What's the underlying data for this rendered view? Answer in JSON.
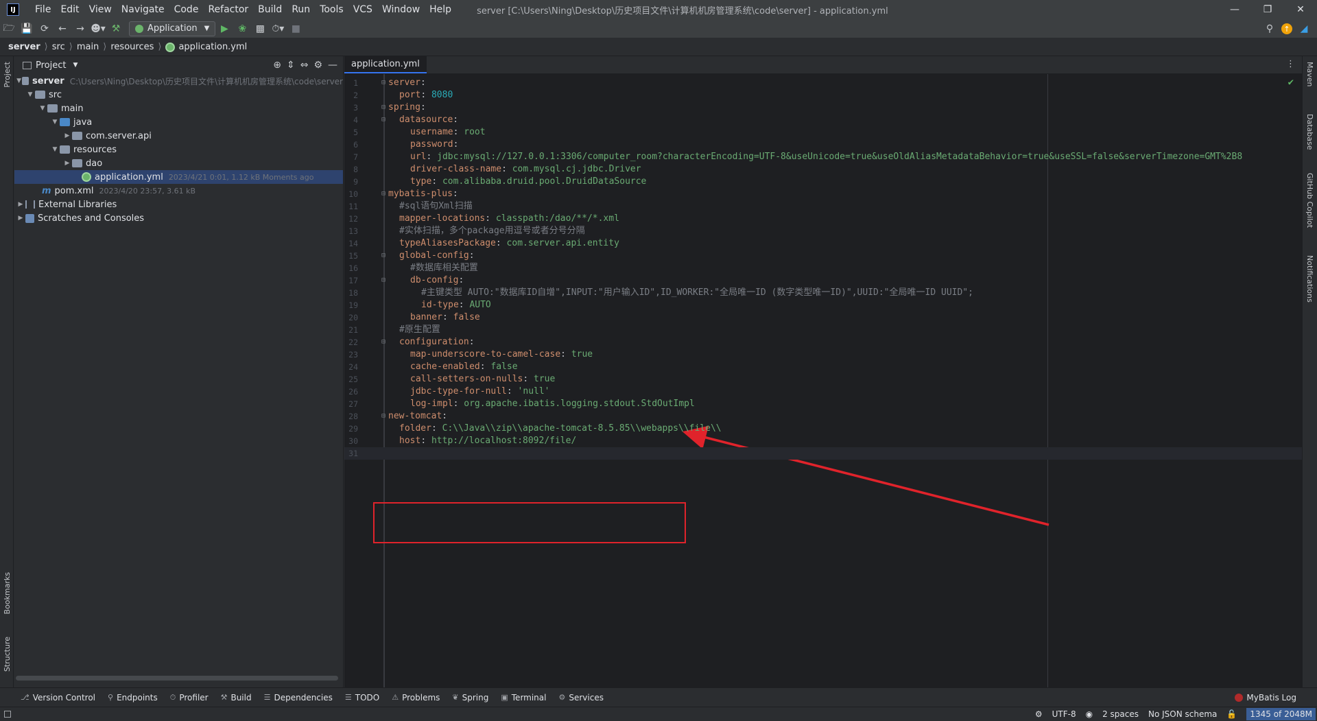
{
  "window": {
    "title": "server [C:\\Users\\Ning\\Desktop\\历史项目文件\\计算机机房管理系统\\code\\server] - application.yml",
    "menu": [
      "File",
      "Edit",
      "View",
      "Navigate",
      "Code",
      "Refactor",
      "Build",
      "Run",
      "Tools",
      "VCS",
      "Window",
      "Help"
    ]
  },
  "toolbar": {
    "run_config": "Application"
  },
  "breadcrumb": [
    "server",
    "src",
    "main",
    "resources",
    "application.yml"
  ],
  "left_stripe": {
    "project": "Project",
    "bookmarks": "Bookmarks",
    "structure": "Structure"
  },
  "project_panel": {
    "title": "Project",
    "tree": {
      "root": {
        "name": "server",
        "path": "C:\\Users\\Ning\\Desktop\\历史项目文件\\计算机机房管理系统\\code\\server"
      },
      "src": "src",
      "main": "main",
      "java": "java",
      "pkg": "com.server.api",
      "resources": "resources",
      "dao": "dao",
      "app_yml": {
        "name": "application.yml",
        "meta": "2023/4/21 0:01, 1.12 kB Moments ago"
      },
      "pom": {
        "name": "pom.xml",
        "meta": "2023/4/20 23:57, 3.61 kB"
      },
      "ext_libs": "External Libraries",
      "scratches": "Scratches and Consoles"
    }
  },
  "editor": {
    "tab": "application.yml",
    "lines": [
      {
        "n": "1",
        "i": 0,
        "parts": [
          [
            "k",
            "server"
          ],
          [
            "p",
            ":"
          ]
        ]
      },
      {
        "n": "2",
        "i": 1,
        "parts": [
          [
            "k",
            "port"
          ],
          [
            "p",
            ": "
          ],
          [
            "n",
            "8080"
          ]
        ]
      },
      {
        "n": "3",
        "i": 0,
        "parts": [
          [
            "k",
            "spring"
          ],
          [
            "p",
            ":"
          ]
        ]
      },
      {
        "n": "4",
        "i": 1,
        "parts": [
          [
            "k",
            "datasource"
          ],
          [
            "p",
            ":"
          ]
        ]
      },
      {
        "n": "5",
        "i": 2,
        "parts": [
          [
            "k",
            "username"
          ],
          [
            "p",
            ": "
          ],
          [
            "v",
            "root"
          ]
        ]
      },
      {
        "n": "6",
        "i": 2,
        "parts": [
          [
            "k",
            "password"
          ],
          [
            "p",
            ":"
          ]
        ]
      },
      {
        "n": "7",
        "i": 2,
        "parts": [
          [
            "k",
            "url"
          ],
          [
            "p",
            ": "
          ],
          [
            "v",
            "jdbc:mysql://127.0.0.1:3306/computer_room?characterEncoding=UTF-8&useUnicode=true&useOldAliasMetadataBehavior=true&useSSL=false&serverTimezone=GMT%2B8"
          ]
        ]
      },
      {
        "n": "8",
        "i": 2,
        "parts": [
          [
            "k",
            "driver-class-name"
          ],
          [
            "p",
            ": "
          ],
          [
            "v",
            "com.mysql.cj.jdbc.Driver"
          ]
        ]
      },
      {
        "n": "9",
        "i": 2,
        "parts": [
          [
            "k",
            "type"
          ],
          [
            "p",
            ": "
          ],
          [
            "v",
            "com.alibaba.druid.pool.DruidDataSource"
          ]
        ]
      },
      {
        "n": "10",
        "i": 0,
        "parts": [
          [
            "k",
            "mybatis-plus"
          ],
          [
            "p",
            ":"
          ]
        ]
      },
      {
        "n": "11",
        "i": 1,
        "parts": [
          [
            "c",
            "#sql语句Xml扫描"
          ]
        ]
      },
      {
        "n": "12",
        "i": 1,
        "parts": [
          [
            "k",
            "mapper-locations"
          ],
          [
            "p",
            ": "
          ],
          [
            "v",
            "classpath:/dao/**/*.xml"
          ]
        ]
      },
      {
        "n": "13",
        "i": 1,
        "parts": [
          [
            "c",
            "#实体扫描，多个package用逗号或者分号分隔"
          ]
        ]
      },
      {
        "n": "14",
        "i": 1,
        "parts": [
          [
            "k",
            "typeAliasesPackage"
          ],
          [
            "p",
            ": "
          ],
          [
            "v",
            "com.server.api.entity"
          ]
        ]
      },
      {
        "n": "15",
        "i": 1,
        "parts": [
          [
            "k",
            "global-config"
          ],
          [
            "p",
            ":"
          ]
        ]
      },
      {
        "n": "16",
        "i": 2,
        "parts": [
          [
            "c",
            "#数据库相关配置"
          ]
        ]
      },
      {
        "n": "17",
        "i": 2,
        "parts": [
          [
            "k",
            "db-config"
          ],
          [
            "p",
            ":"
          ]
        ]
      },
      {
        "n": "18",
        "i": 3,
        "parts": [
          [
            "c",
            "#主键类型 AUTO:\"数据库ID自增\",INPUT:\"用户输入ID\",ID_WORKER:\"全局唯一ID (数字类型唯一ID)\",UUID:\"全局唯一ID UUID\";"
          ]
        ]
      },
      {
        "n": "19",
        "i": 3,
        "parts": [
          [
            "k",
            "id-type"
          ],
          [
            "p",
            ": "
          ],
          [
            "v",
            "AUTO"
          ]
        ]
      },
      {
        "n": "20",
        "i": 2,
        "parts": [
          [
            "k",
            "banner"
          ],
          [
            "p",
            ": "
          ],
          [
            "k",
            "false"
          ]
        ]
      },
      {
        "n": "21",
        "i": 1,
        "parts": [
          [
            "c",
            "#原生配置"
          ]
        ]
      },
      {
        "n": "22",
        "i": 1,
        "parts": [
          [
            "k",
            "configuration"
          ],
          [
            "p",
            ":"
          ]
        ]
      },
      {
        "n": "23",
        "i": 2,
        "parts": [
          [
            "k",
            "map-underscore-to-camel-case"
          ],
          [
            "p",
            ": "
          ],
          [
            "v",
            "true"
          ]
        ]
      },
      {
        "n": "24",
        "i": 2,
        "parts": [
          [
            "k",
            "cache-enabled"
          ],
          [
            "p",
            ": "
          ],
          [
            "v",
            "false"
          ]
        ]
      },
      {
        "n": "25",
        "i": 2,
        "parts": [
          [
            "k",
            "call-setters-on-nulls"
          ],
          [
            "p",
            ": "
          ],
          [
            "v",
            "true"
          ]
        ]
      },
      {
        "n": "26",
        "i": 2,
        "parts": [
          [
            "k",
            "jdbc-type-for-null"
          ],
          [
            "p",
            ": "
          ],
          [
            "v",
            "'null'"
          ]
        ]
      },
      {
        "n": "27",
        "i": 2,
        "parts": [
          [
            "k",
            "log-impl"
          ],
          [
            "p",
            ": "
          ],
          [
            "v",
            "org.apache.ibatis.logging.stdout.StdOutImpl"
          ]
        ]
      },
      {
        "n": "28",
        "i": 0,
        "parts": [
          [
            "k",
            "new-tomcat"
          ],
          [
            "p",
            ":"
          ]
        ]
      },
      {
        "n": "29",
        "i": 1,
        "parts": [
          [
            "k",
            "folder"
          ],
          [
            "p",
            ": "
          ],
          [
            "v",
            "C:\\\\Java\\\\zip\\\\apache-tomcat-8.5.85\\\\webapps\\\\file\\\\"
          ]
        ]
      },
      {
        "n": "30",
        "i": 1,
        "parts": [
          [
            "k",
            "host"
          ],
          [
            "p",
            ": "
          ],
          [
            "v",
            "http://localhost:8092/file/"
          ]
        ]
      },
      {
        "n": "31",
        "i": 0,
        "parts": []
      }
    ]
  },
  "right_stripe": {
    "maven": "Maven",
    "database": "Database",
    "copilot": "GitHub Copilot",
    "notifications": "Notifications"
  },
  "bottom_tools": [
    "Version Control",
    "Endpoints",
    "Profiler",
    "Build",
    "Dependencies",
    "TODO",
    "Problems",
    "Spring",
    "Terminal",
    "Services"
  ],
  "mybatis_log": "MyBatis Log",
  "status": {
    "encoding": "UTF-8",
    "indent": "2 spaces",
    "schema": "No JSON schema",
    "memory": "1345 of 2048M"
  },
  "colors": {
    "accent": "#3574f0",
    "annotation": "#e0232b"
  }
}
